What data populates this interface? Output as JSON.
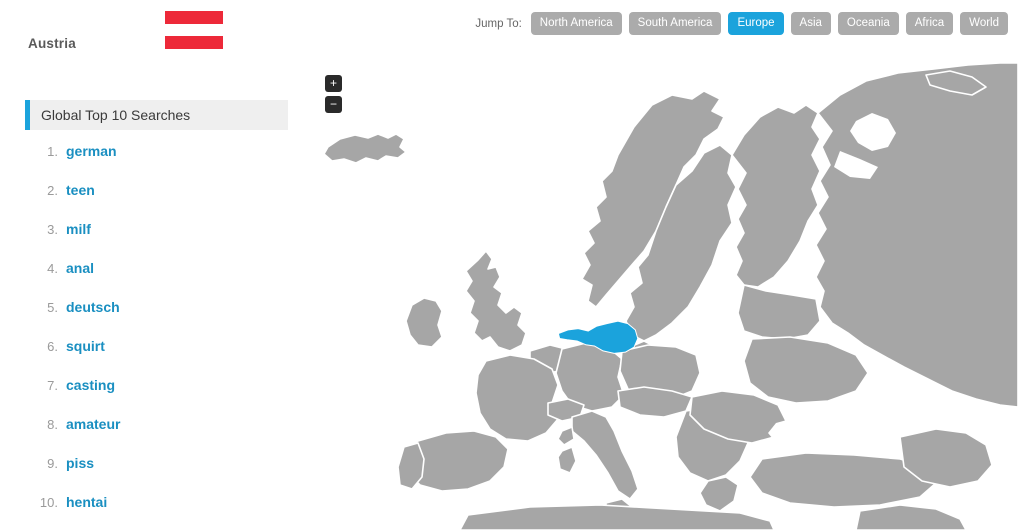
{
  "country": {
    "name": "Austria",
    "flag": {
      "type": "horizontal-triband",
      "bands": [
        "#ED2939",
        "#FFFFFF",
        "#ED2939"
      ]
    }
  },
  "jump_nav": {
    "label": "Jump To:",
    "items": [
      {
        "label": "North America",
        "active": false
      },
      {
        "label": "South America",
        "active": false
      },
      {
        "label": "Europe",
        "active": true
      },
      {
        "label": "Asia",
        "active": false
      },
      {
        "label": "Oceania",
        "active": false
      },
      {
        "label": "Africa",
        "active": false
      },
      {
        "label": "World",
        "active": false
      }
    ]
  },
  "panel": {
    "title": "Global Top 10 Searches",
    "items": [
      {
        "rank": "1.",
        "term": "german"
      },
      {
        "rank": "2.",
        "term": "teen"
      },
      {
        "rank": "3.",
        "term": "milf"
      },
      {
        "rank": "4.",
        "term": "anal"
      },
      {
        "rank": "5.",
        "term": "deutsch"
      },
      {
        "rank": "6.",
        "term": "squirt"
      },
      {
        "rank": "7.",
        "term": "casting"
      },
      {
        "rank": "8.",
        "term": "amateur"
      },
      {
        "rank": "9.",
        "term": "piss"
      },
      {
        "rank": "10.",
        "term": "hentai"
      }
    ]
  },
  "map": {
    "region": "Europe",
    "highlighted_country": "Austria",
    "zoom_in_label": "+",
    "zoom_out_label": "−",
    "colors": {
      "land": "#A6A6A6",
      "border": "#FFFFFF",
      "water": "#FFFFFF",
      "highlight": "#1BA3DC"
    }
  },
  "colors": {
    "accent": "#1BA3DC",
    "link": "#1A8FC1",
    "rank": "#9A9A9A",
    "panel_bg": "#EFEFEF",
    "button_bg": "#ABABAB",
    "flag_red": "#ED2939"
  }
}
